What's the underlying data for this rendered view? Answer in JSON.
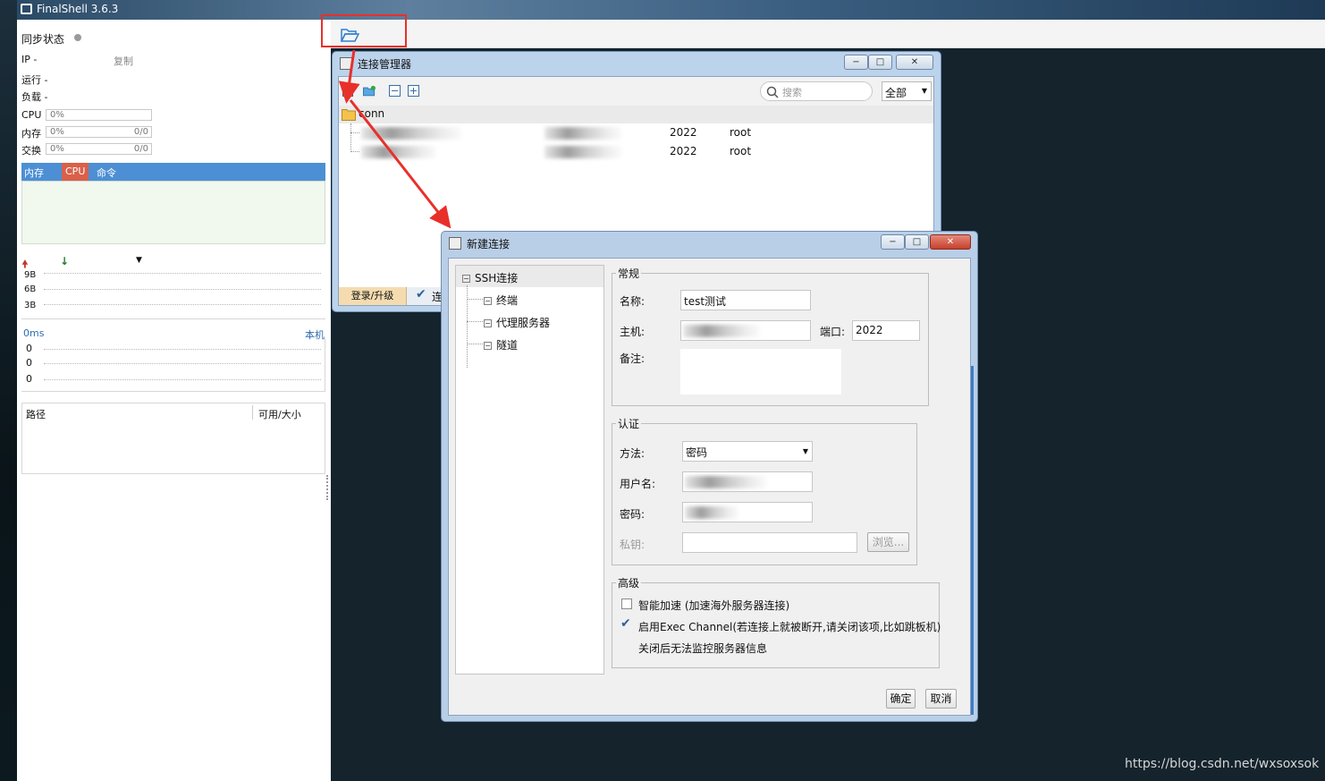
{
  "app": {
    "title": "FinalShell 3.6.3"
  },
  "left_panel": {
    "sync_label": "同步状态",
    "ip_label": "IP  -",
    "copy_label": "复制",
    "run_label": "运行 -",
    "load_label": "负载 -",
    "cpu_label": "CPU",
    "cpu_value": "0%",
    "mem_label": "内存",
    "mem_value": "0%",
    "mem_ratio": "0/0",
    "swap_label": "交换",
    "swap_value": "0%",
    "swap_ratio": "0/0",
    "proc_tabs": [
      "内存",
      "CPU",
      "命令"
    ],
    "net_ticks": [
      "9B",
      "6B",
      "3B"
    ],
    "ping_label": "0ms",
    "ping_host": "本机",
    "ping_ticks": [
      "0",
      "0",
      "0"
    ],
    "disk_path_header": "路径",
    "disk_size_header": "可用/大小"
  },
  "conn_manager": {
    "title": "连接管理器",
    "search_placeholder": "搜索",
    "filter_value": "全部",
    "folder_name": "conn",
    "rows": [
      {
        "port": "2022",
        "user": "root"
      },
      {
        "port": "2022",
        "user": "root"
      }
    ],
    "bottom_tab": "登录/升级",
    "bottom_check_label": "连"
  },
  "new_conn": {
    "title": "新建连接",
    "tree": {
      "root": "SSH连接",
      "children": [
        "终端",
        "代理服务器",
        "隧道"
      ]
    },
    "general": {
      "legend": "常规",
      "name_label": "名称:",
      "name_value": "test测试",
      "host_label": "主机:",
      "port_label": "端口:",
      "port_value": "2022",
      "note_label": "备注:"
    },
    "auth": {
      "legend": "认证",
      "method_label": "方法:",
      "method_value": "密码",
      "user_label": "用户名:",
      "password_label": "密码:",
      "key_label": "私钥:",
      "browse_label": "浏览..."
    },
    "advanced": {
      "legend": "高级",
      "smart_accel": "智能加速 (加速海外服务器连接)",
      "exec_channel": "启用Exec Channel(若连接上就被断开,请关闭该项,比如跳板机)",
      "exec_note": "关闭后无法监控服务器信息",
      "smart_accel_checked": false,
      "exec_channel_checked": true
    },
    "ok_label": "确定",
    "cancel_label": "取消"
  },
  "watermark": "https://blog.csdn.net/wxsoxsok",
  "colors": {
    "accent": "#4d8fd4",
    "highlight": "#e8302a",
    "cpu_tab": "#d9604a"
  }
}
